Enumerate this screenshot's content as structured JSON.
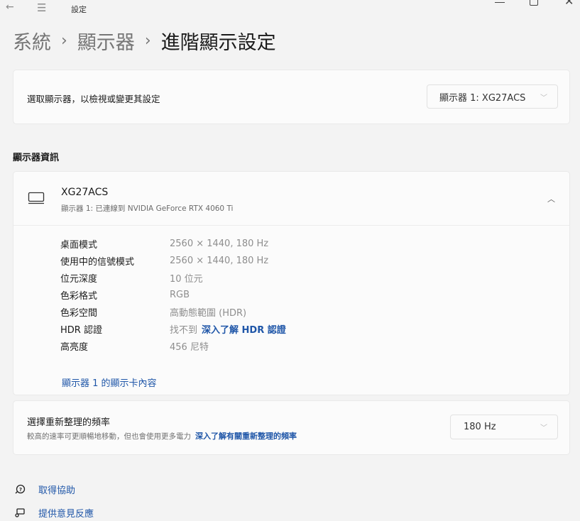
{
  "window": {
    "title": "設定"
  },
  "breadcrumb": {
    "items": [
      "系統",
      "顯示器"
    ],
    "current": "進階顯示設定",
    "separator": "›"
  },
  "display_select": {
    "label": "選取顯示器，以檢視或變更其設定",
    "selected": "顯示器 1: XG27ACS"
  },
  "section": {
    "title": "顯示器資訊"
  },
  "monitor": {
    "name": "XG27ACS",
    "subtitle": "顯示器 1: 已連線到 NVIDIA GeForce RTX 4060 Ti",
    "specs": [
      {
        "key": "桌面模式",
        "value": "2560 × 1440, 180 Hz"
      },
      {
        "key": "使用中的信號模式",
        "value": "2560 × 1440, 180 Hz"
      },
      {
        "key": "位元深度",
        "value": "10 位元"
      },
      {
        "key": "色彩格式",
        "value": "RGB"
      },
      {
        "key": "色彩空間",
        "value": "高動態範圍 (HDR)"
      },
      {
        "key": "HDR 認證",
        "value": "找不到",
        "link": "深入了解 HDR 認證"
      },
      {
        "key": "高亮度",
        "value": "456 尼特"
      }
    ],
    "adapter_link": "顯示器 1 的顯示卡內容"
  },
  "refresh_rate": {
    "title": "選擇重新整理的頻率",
    "subtitle": "較高的速率可更順暢地移動，但也會使用更多電力",
    "link": "深入了解有關重新整理的頻率",
    "selected": "180 Hz"
  },
  "footer": {
    "help": "取得協助",
    "feedback": "提供意見反應"
  },
  "colors": {
    "accent_link": "#1f56a8",
    "background": "#f3f3f3",
    "card": "#fbfbfb"
  }
}
